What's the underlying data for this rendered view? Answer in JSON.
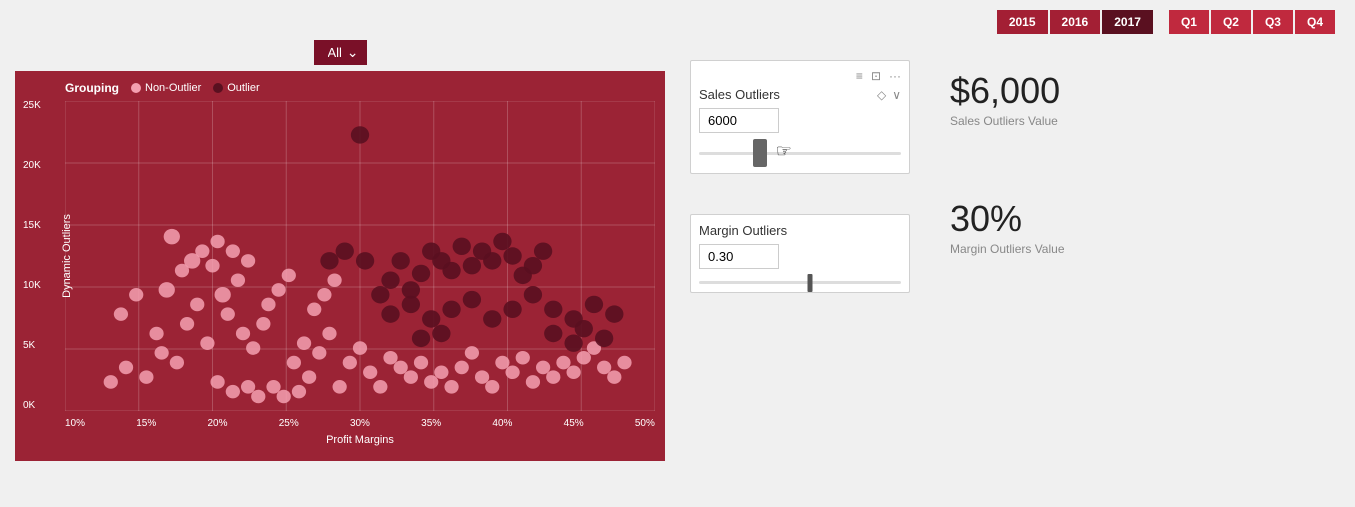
{
  "topBar": {
    "years": [
      {
        "label": "2015",
        "active": false
      },
      {
        "label": "2016",
        "active": false
      },
      {
        "label": "2017",
        "active": true
      }
    ],
    "quarters": [
      {
        "label": "Q1"
      },
      {
        "label": "Q2"
      },
      {
        "label": "Q3"
      },
      {
        "label": "Q4"
      }
    ]
  },
  "dropdown": {
    "value": "All",
    "placeholder": "All"
  },
  "chart": {
    "title": "Grouping",
    "legend": {
      "title": "Grouping",
      "items": [
        {
          "label": "Non-Outlier",
          "color": "#f4a0b0"
        },
        {
          "label": "Outlier",
          "color": "#5a1020"
        }
      ]
    },
    "yAxisLabel": "Dynamic Outliers",
    "xAxisLabel": "Profit Margins",
    "yTicks": [
      "25K",
      "20K",
      "15K",
      "10K",
      "5K",
      "0K"
    ],
    "xTicks": [
      "10%",
      "15%",
      "20%",
      "25%",
      "30%",
      "35%",
      "40%",
      "45%",
      "50%"
    ]
  },
  "salesCard": {
    "title": "Sales Outliers",
    "inputValue": "6000",
    "icons": [
      "◇",
      "∨"
    ]
  },
  "marginCard": {
    "title": "Margin Outliers",
    "inputValue": "0.30"
  },
  "kpis": {
    "sales": {
      "value": "$6,000",
      "label": "Sales Outliers Value"
    },
    "margin": {
      "value": "30%",
      "label": "Margin Outliers Value"
    }
  }
}
